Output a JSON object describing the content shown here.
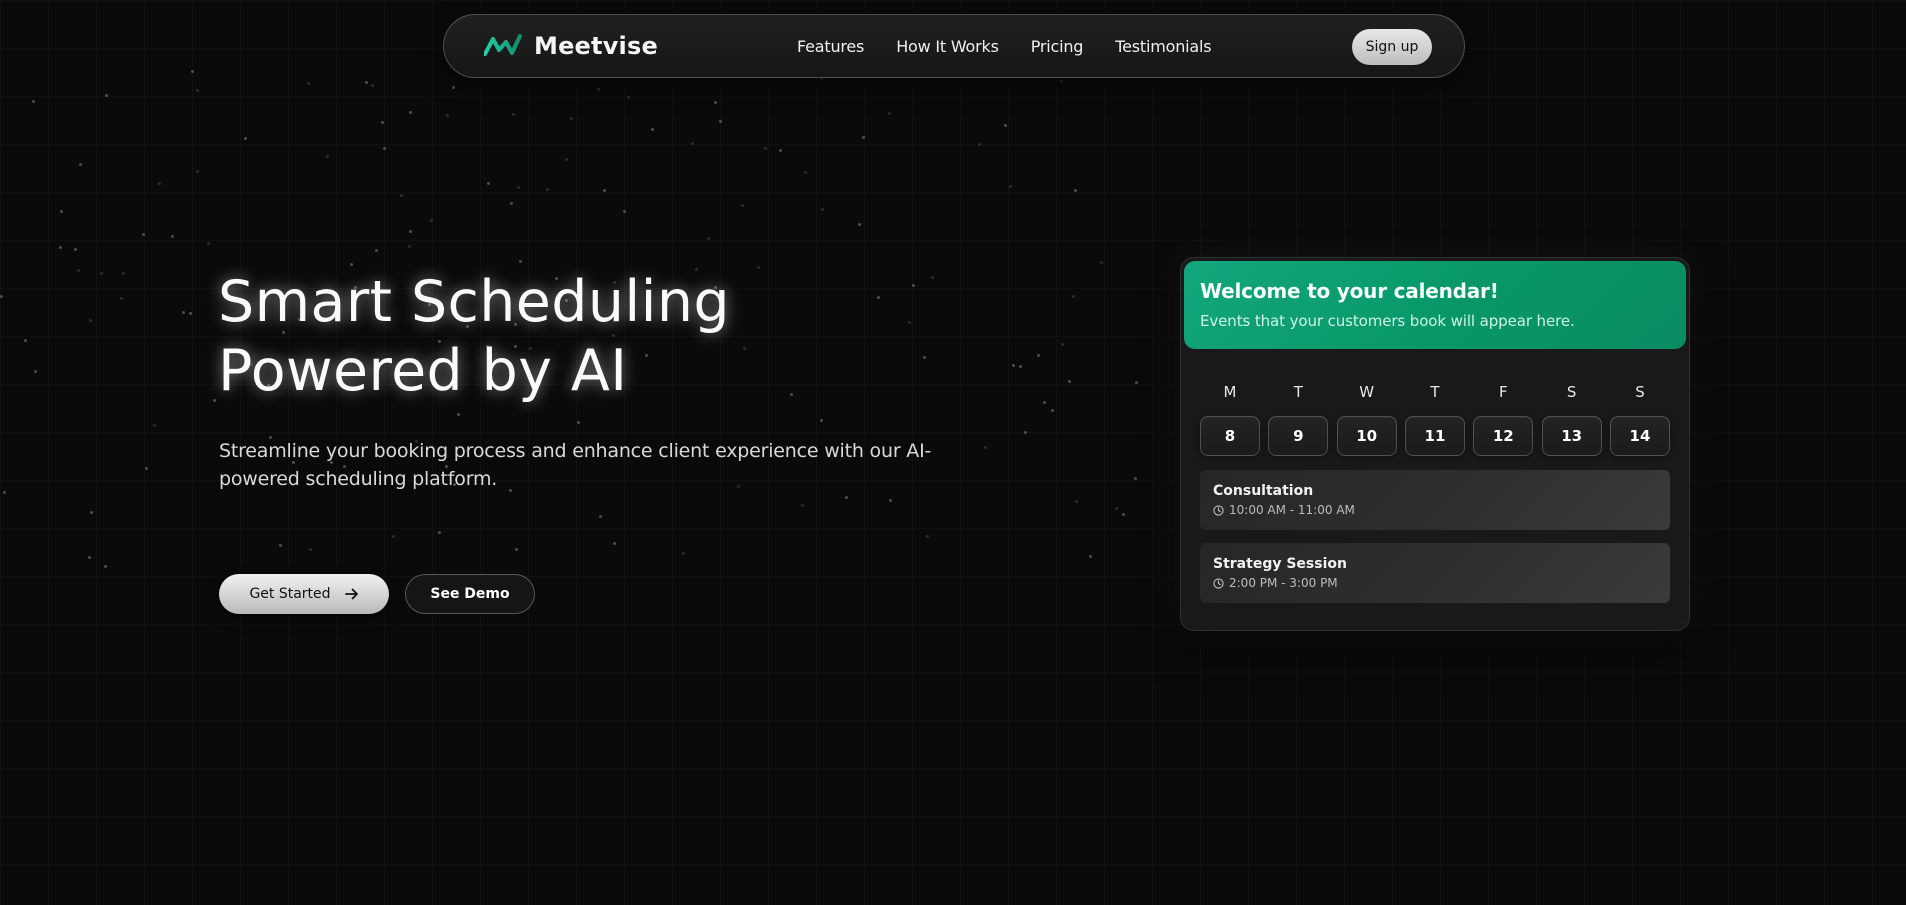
{
  "nav": {
    "brand": "Meetvise",
    "links": [
      "Features",
      "How It Works",
      "Pricing",
      "Testimonials"
    ],
    "signup_label": "Sign up"
  },
  "hero": {
    "title_line1": "Smart Scheduling",
    "title_line2": "Powered by AI",
    "subtitle": "Streamline your booking process and enhance client experience with our AI-powered scheduling platform.",
    "primary_cta": "Get Started",
    "secondary_cta": "See Demo"
  },
  "calendar": {
    "title": "Welcome to your calendar!",
    "description": "Events that your customers book will appear here.",
    "weekdays": [
      "M",
      "T",
      "W",
      "T",
      "F",
      "S",
      "S"
    ],
    "dates": [
      "8",
      "9",
      "10",
      "11",
      "12",
      "13",
      "14"
    ],
    "events": [
      {
        "title": "Consultation",
        "time": "10:00 AM - 11:00 AM"
      },
      {
        "title": "Strategy Session",
        "time": "2:00 PM - 3:00 PM"
      }
    ]
  },
  "icons": {
    "logo": "mountain-wave-logo-icon",
    "cta_arrow": "arrow-right-icon",
    "event_time": "clock-icon"
  },
  "colors": {
    "background": "#0a0a0a",
    "accent_green": "#079767",
    "brand_gradient_start": "#19c9a0",
    "text_primary": "#ffffff"
  }
}
